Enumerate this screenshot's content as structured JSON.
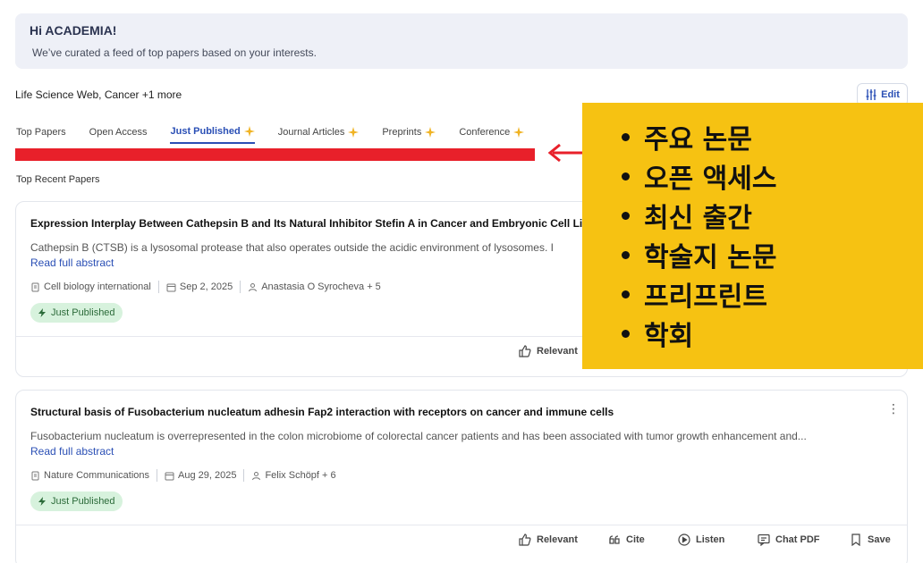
{
  "greeting": {
    "title": "Hi ACADEMIA!",
    "subtitle": "We’ve curated a feed of top papers based on your interests."
  },
  "interests": "Life Science Web, Cancer +1 more",
  "edit_label": "Edit",
  "tabs": [
    {
      "label": "Top Papers",
      "sparkle": false,
      "active": false
    },
    {
      "label": "Open Access",
      "sparkle": false,
      "active": false
    },
    {
      "label": "Just Published",
      "sparkle": true,
      "active": true
    },
    {
      "label": "Journal Articles",
      "sparkle": true,
      "active": false
    },
    {
      "label": "Preprints",
      "sparkle": true,
      "active": false
    },
    {
      "label": "Conference",
      "sparkle": true,
      "active": false
    }
  ],
  "section_label": "Top Recent Papers",
  "papers": [
    {
      "title": "Expression Interplay Between Cathepsin B and Its Natural Inhibitor Stefin A in Cancer and Embryonic Cell Lines.",
      "abstract": "Cathepsin B (CTSB) is a lysosomal protease that also operates outside the acidic environment of lysosomes. I",
      "read_more": "Read full abstract",
      "journal": "Cell biology international",
      "date": "Sep 2, 2025",
      "authors": "Anastasia O Syrocheva + 5",
      "badge": "Just Published",
      "actions": [
        "Relevant"
      ]
    },
    {
      "title": "Structural basis of Fusobacterium nucleatum adhesin Fap2 interaction with receptors on cancer and immune cells",
      "abstract": "Fusobacterium nucleatum is overrepresented in the colon microbiome of colorectal cancer patients and has been associated with tumor growth enhancement and...",
      "read_more": "Read full abstract",
      "journal": "Nature Communications",
      "date": "Aug 29, 2025",
      "authors": "Felix Schöpf + 6",
      "badge": "Just Published",
      "actions": [
        "Relevant",
        "Cite",
        "Listen",
        "Chat PDF",
        "Save"
      ]
    }
  ],
  "overlay": {
    "items": [
      "주요 논문",
      "오픈 액세스",
      "최신 출간",
      "학술지 논문",
      "프리프린트",
      "학회"
    ]
  },
  "colors": {
    "accent": "#2a4fb5",
    "red_bar": "#e8202a",
    "overlay_bg": "#f6c212",
    "badge_bg": "#d7f2dd"
  }
}
